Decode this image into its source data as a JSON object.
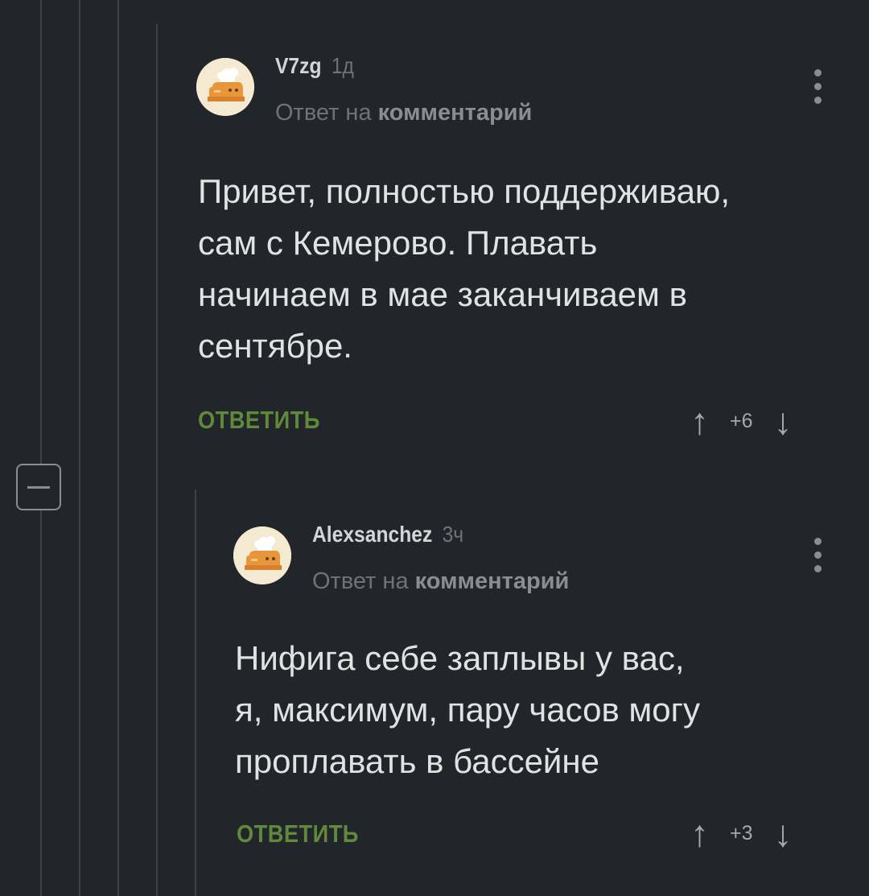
{
  "comments": [
    {
      "author": "V7zg",
      "time": "1д",
      "reply_prefix": "Ответ на",
      "reply_target": "комментарий",
      "body": "Привет, полностью поддерживаю,\nсам с Кемерово. Плавать\nначинаем в мае заканчиваем в\nсентябре.",
      "reply_label": "ОТВЕТИТЬ",
      "score": "+6"
    },
    {
      "author": "Alexsanchez",
      "time": "3ч",
      "reply_prefix": "Ответ на",
      "reply_target": "комментарий",
      "body": "Нифига себе заплывы у вас,\nя, максимум, пару часов могу\nпроплавать в бассейне",
      "reply_label": "ОТВЕТИТЬ",
      "score": "+3"
    }
  ],
  "icons": {
    "upvote": "↑",
    "downvote": "↓"
  },
  "colors": {
    "background": "#222529",
    "reply_button": "#5f8a3b",
    "thread_line": "#3e4247"
  }
}
